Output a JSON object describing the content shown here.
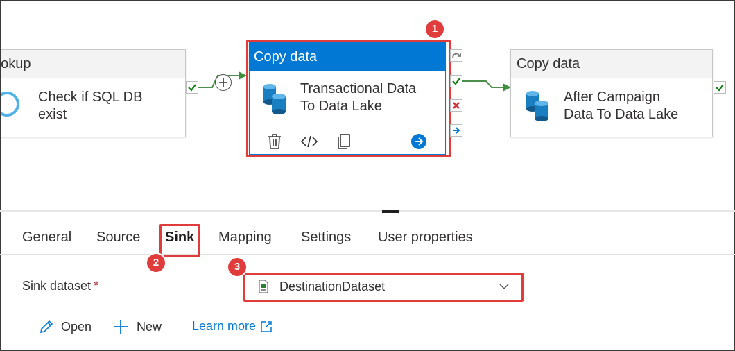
{
  "canvas": {
    "lookup": {
      "title": "ookup",
      "text_line1": "Check if SQL DB",
      "text_line2": "exist"
    },
    "copy1": {
      "title": "Copy data",
      "text_line1": "Transactional Data",
      "text_line2": "To Data Lake",
      "toolbar_icons": [
        "delete-icon",
        "code-icon",
        "clone-icon",
        "go-arrow-icon"
      ]
    },
    "copy2": {
      "title": "Copy data",
      "text_line1": "After Campaign",
      "text_line2": "Data To Data Lake"
    },
    "badges": {
      "one": "1",
      "two": "2",
      "three": "3"
    }
  },
  "tabs": [
    "General",
    "Source",
    "Sink",
    "Mapping",
    "Settings",
    "User properties"
  ],
  "active_tab": "Sink",
  "sink": {
    "dataset_label": "Sink dataset",
    "required_marker": "*",
    "dataset_value": "DestinationDataset"
  },
  "actions": {
    "open": "Open",
    "new": "New",
    "learn_more": "Learn more"
  },
  "colors": {
    "accent": "#0078d4",
    "success": "#107c10",
    "error": "#d13438",
    "highlight": "#e03c3c"
  }
}
